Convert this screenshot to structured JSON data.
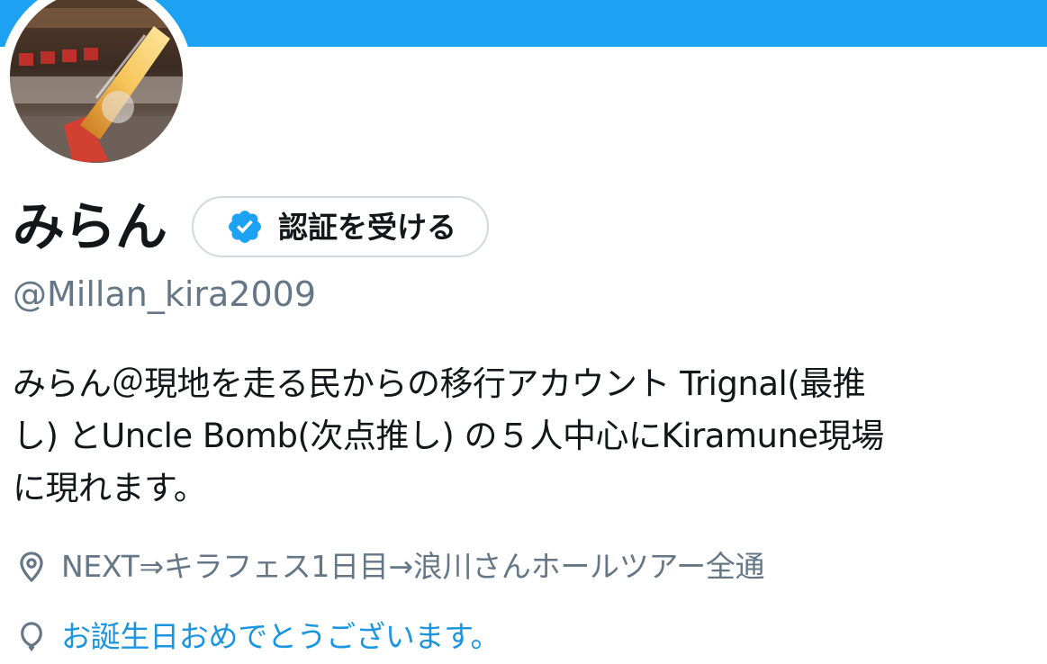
{
  "profile": {
    "display_name": "みらん",
    "handle": "@Millan_kira2009",
    "verify_button_label": "認証を受ける",
    "bio_lines": [
      "みらん＠現地を走る民からの移行アカウント Trignal(最推",
      "し) とUncle Bomb(次点推し) の５人中心にKiramune現場",
      "に現れます。"
    ],
    "location": "NEXT⇒キラフェス1日目→浪川さんホールツアー全通",
    "birthday_text": "お誕生日おめでとうございます。"
  },
  "colors": {
    "banner": "#1da1f2",
    "verify_badge": "#1da1f2",
    "secondary_text": "#657786",
    "link_text": "#1b95e0"
  },
  "icons": {
    "location": "location-pin-icon",
    "birthday": "balloon-icon",
    "verify": "verified-badge-icon"
  }
}
